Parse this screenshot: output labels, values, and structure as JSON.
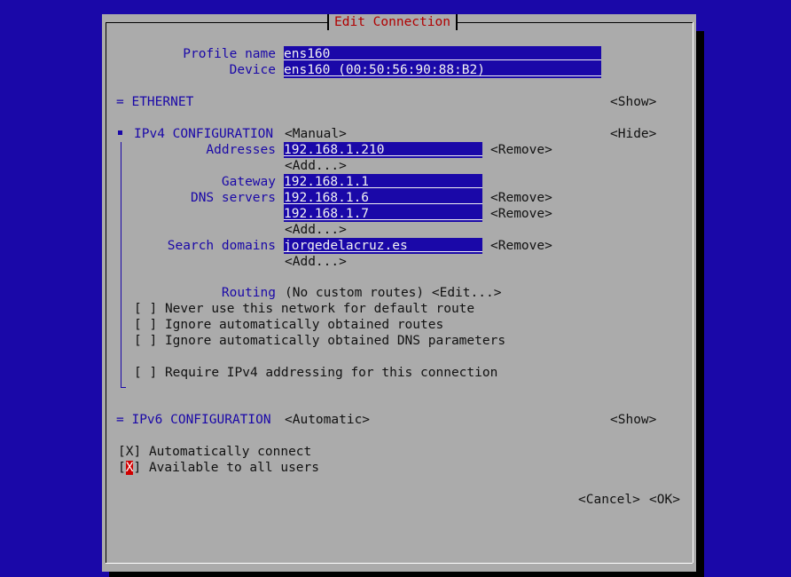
{
  "title": "Edit Connection",
  "profile": {
    "profile_name_label": "Profile name",
    "profile_name_value": "ens160",
    "device_label": "Device",
    "device_value": "ens160 (00:50:56:90:88:B2)"
  },
  "ethernet": {
    "header": "= ETHERNET",
    "toggle": "<Show>"
  },
  "ipv4": {
    "header": "IPv4 CONFIGURATION",
    "mode": "<Manual>",
    "toggle": "<Hide>",
    "addresses_label": "Addresses",
    "addresses": [
      "192.168.1.210"
    ],
    "gateway_label": "Gateway",
    "gateway_value": "192.168.1.1",
    "dns_label": "DNS servers",
    "dns": [
      "192.168.1.6",
      "192.168.1.7"
    ],
    "search_label": "Search domains",
    "search_domains": [
      "jorgedelacruz.es"
    ],
    "remove": "<Remove>",
    "add": "<Add...>",
    "routing_label": "Routing",
    "routing_value": "(No custom routes) <Edit...>",
    "checkboxes": [
      {
        "mark": "[ ]",
        "label": "Never use this network for default route"
      },
      {
        "mark": "[ ]",
        "label": "Ignore automatically obtained routes"
      },
      {
        "mark": "[ ]",
        "label": "Ignore automatically obtained DNS parameters"
      },
      {
        "mark": "[ ]",
        "label": "Require IPv4 addressing for this connection"
      }
    ]
  },
  "ipv6": {
    "header": "= IPv6 CONFIGURATION",
    "mode": "<Automatic>",
    "toggle": "<Show>"
  },
  "general": {
    "auto_connect_mark": "[X]",
    "auto_connect_label": "Automatically connect",
    "all_users_open": "[",
    "all_users_x": "X",
    "all_users_close": "]",
    "all_users_label": "Available to all users"
  },
  "buttons": {
    "cancel": "<Cancel>",
    "ok": "<OK>"
  },
  "colors": {
    "background": "#1a08a8",
    "dialog": "#ababab",
    "title": "#b00000",
    "field": "#1a08a8",
    "cursor": "#d00000"
  }
}
